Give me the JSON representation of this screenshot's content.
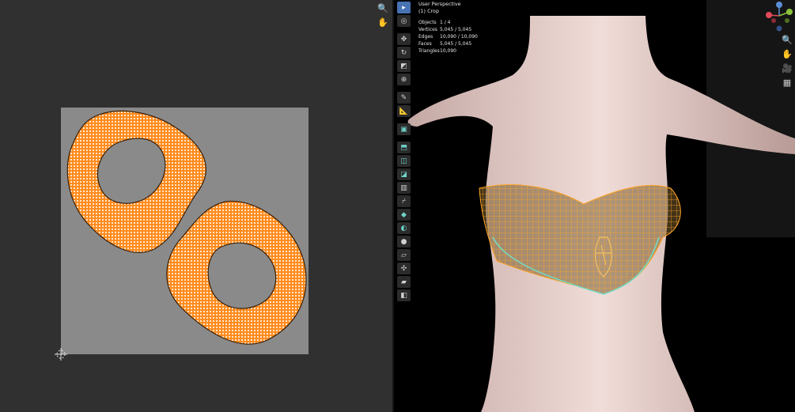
{
  "uv_editor": {
    "nav_icons": [
      "zoom-icon",
      "hand-pan-icon"
    ],
    "colors": {
      "background": "#303030",
      "image": "#8a8a8a",
      "uv_fill": "#ff8a1c",
      "uv_edge": "#3a1f06"
    }
  },
  "viewport": {
    "perspective_label": "User Perspective",
    "object_label": "(1) Crop",
    "stats": [
      {
        "label": "Objects",
        "value": "1 / 4"
      },
      {
        "label": "Vertices",
        "value": "5,045 / 5,045"
      },
      {
        "label": "Edges",
        "value": "10,090 / 10,090"
      },
      {
        "label": "Faces",
        "value": "5,045 / 5,045"
      },
      {
        "label": "Triangles",
        "value": "10,090"
      }
    ],
    "tools": [
      "select-box",
      "cursor",
      "move",
      "rotate",
      "scale",
      "transform",
      "annotate",
      "measure",
      "add-cube",
      "extrude-region",
      "inset-faces",
      "bevel",
      "loop-cut",
      "knife",
      "poly-build",
      "spin",
      "smooth",
      "edge-slide",
      "shrink-fatten",
      "shear",
      "rip-region"
    ],
    "nav_icons": [
      "zoom-icon",
      "hand-pan-icon",
      "camera-icon",
      "grid-icon"
    ],
    "gizmo_axes": [
      "Z",
      "Y",
      "X"
    ],
    "colors": {
      "selection": "#ff9a1f",
      "active_edge": "#6fe0c8",
      "skin": "#ead0cb"
    }
  }
}
